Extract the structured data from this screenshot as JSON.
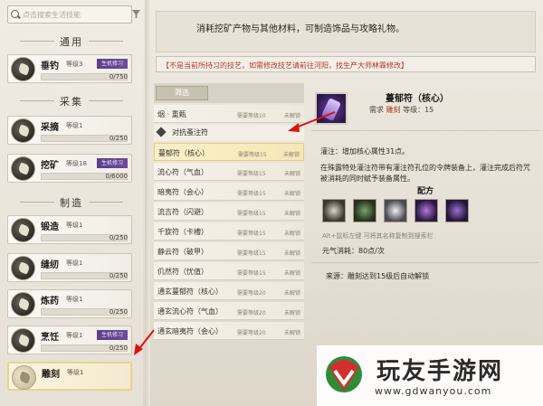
{
  "search": {
    "placeholder": "点击搜索生活技能"
  },
  "sidebar": {
    "categories": [
      "通用",
      "采集",
      "制造"
    ],
    "skills": [
      {
        "name": "垂钓",
        "level": "等级3",
        "badge": "生机修习",
        "progress": "0/750",
        "fill": 0
      },
      {
        "name": "采摘",
        "level": "等级1",
        "badge": "",
        "progress": "0/250",
        "fill": 0
      },
      {
        "name": "挖矿",
        "level": "等级18",
        "badge": "生机修习",
        "progress": "0/6000",
        "fill": 0
      },
      {
        "name": "锻造",
        "level": "等级1",
        "badge": "",
        "progress": "0/250",
        "fill": 0
      },
      {
        "name": "缝纫",
        "level": "等级1",
        "badge": "",
        "progress": "0/250",
        "fill": 0
      },
      {
        "name": "炼药",
        "level": "等级1",
        "badge": "",
        "progress": "0/250",
        "fill": 0
      },
      {
        "name": "烹饪",
        "level": "等级1",
        "badge": "生机修习",
        "progress": "0/250",
        "fill": 0
      },
      {
        "name": "雕刻",
        "level": "等级1",
        "badge": "",
        "progress": "",
        "fill": 0
      }
    ]
  },
  "header": {
    "description": "消耗挖矿产物与其他材料，可制造饰品与攻略礼物。",
    "note": "【不是当前所持习的技艺，如需修改技艺请前往河阳，找生产大师林霖修改】"
  },
  "list": {
    "filter_label": "筛选",
    "top_row": {
      "name": "烟 · 重甄",
      "req": "需要等级10",
      "status": "未解锁"
    },
    "group": "对抗蚤注符",
    "rows": [
      {
        "name": "蔓郁符（核心）",
        "req": "需要等级15",
        "status": "未解锁",
        "selected": true
      },
      {
        "name": "流心符（气血）",
        "req": "需要等级15",
        "status": "未解锁"
      },
      {
        "name": "暗夷符（会心）",
        "req": "需要等级15",
        "status": "未解锁"
      },
      {
        "name": "流吉符（闪避）",
        "req": "需要等级15",
        "status": "未解锁"
      },
      {
        "name": "千旋符（卡槽）",
        "req": "需要等级15",
        "status": "未解锁"
      },
      {
        "name": "静云符（破甲）",
        "req": "需要等级15",
        "status": "未解锁"
      },
      {
        "name": "仉然符（忧值）",
        "req": "需要等级15",
        "status": "未解锁"
      },
      {
        "name": "通玄蔓郁符（核心）",
        "req": "需要等级20",
        "status": "未解锁"
      },
      {
        "name": "通玄流心符（气血）",
        "req": "需要等级20",
        "status": "未解锁"
      },
      {
        "name": "通玄暗夷符（会心）",
        "req": "需要等级20",
        "status": "未解锁"
      }
    ]
  },
  "detail": {
    "title": "蔓郁符（核心）",
    "req_prefix": "需求",
    "req_highlight": "雕刻",
    "req_suffix": "等级：15",
    "effect": "灌注：增加核心属性31点。",
    "body": "在殊露特处灌注符带有灌注符孔位的令牌装备上，灌注完成后符咒被消耗的同时赋予装备属性。",
    "recipe_heading": "配方",
    "tip": "Alt+鼠标左键 可将其名称复制到搜索栏",
    "cost": "元气消耗：80点/次",
    "source": "来源：雕刻达到15级后自动解锁"
  },
  "watermark": {
    "brand": "玩友手游网",
    "url": "www.gdwanyou.com"
  },
  "colors": {
    "accent": "#b33a2a",
    "badge": "#5a3f86",
    "selected": "#f5e7b7"
  }
}
